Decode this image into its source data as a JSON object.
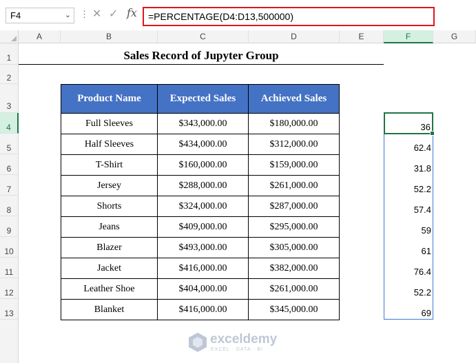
{
  "formula_bar": {
    "name_box": "F4",
    "formula": "=PERCENTAGE(D4:D13,500000)"
  },
  "columns": [
    "A",
    "B",
    "C",
    "D",
    "E",
    "F",
    "G"
  ],
  "rows": [
    "1",
    "2",
    "3",
    "4",
    "5",
    "6",
    "7",
    "8",
    "9",
    "10",
    "11",
    "12",
    "13"
  ],
  "title": "Sales Record of Jupyter Group",
  "table": {
    "headers": [
      "Product Name",
      "Expected Sales",
      "Achieved Sales"
    ],
    "rows": [
      [
        "Full Sleeves",
        "$343,000.00",
        "$180,000.00"
      ],
      [
        "Half Sleeves",
        "$434,000.00",
        "$312,000.00"
      ],
      [
        "T-Shirt",
        "$160,000.00",
        "$159,000.00"
      ],
      [
        "Jersey",
        "$288,000.00",
        "$261,000.00"
      ],
      [
        "Shorts",
        "$324,000.00",
        "$287,000.00"
      ],
      [
        "Jeans",
        "$409,000.00",
        "$295,000.00"
      ],
      [
        "Blazer",
        "$493,000.00",
        "$305,000.00"
      ],
      [
        "Jacket",
        "$416,000.00",
        "$382,000.00"
      ],
      [
        "Leather Shoe",
        "$404,000.00",
        "$261,000.00"
      ],
      [
        "Blanket",
        "$416,000.00",
        "$345,000.00"
      ]
    ]
  },
  "results": [
    "36",
    "62.4",
    "31.8",
    "52.2",
    "57.4",
    "59",
    "61",
    "76.4",
    "52.2",
    "69"
  ],
  "watermark": {
    "name": "exceldemy",
    "tagline": "EXCEL · DATA · BI"
  }
}
